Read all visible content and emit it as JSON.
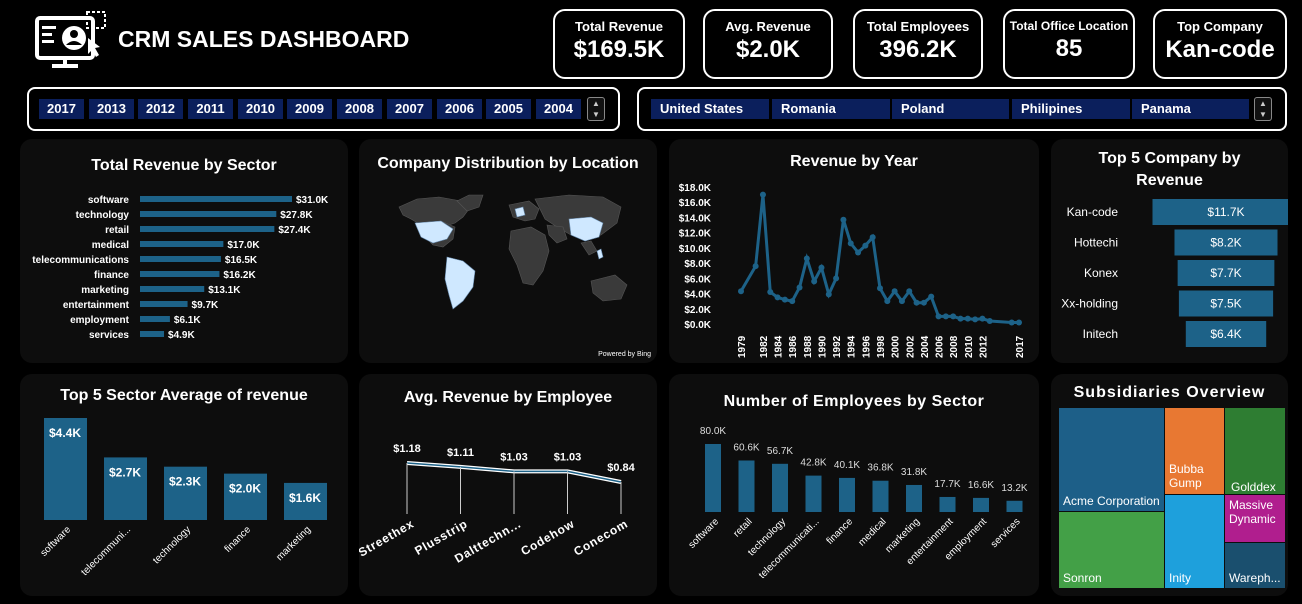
{
  "header": {
    "title": "CRM SALES DASHBOARD"
  },
  "kpis": [
    {
      "label": "Total Revenue",
      "value": "$169.5K"
    },
    {
      "label": "Avg. Revenue",
      "value": "$2.0K"
    },
    {
      "label": "Total Employees",
      "value": "396.2K"
    },
    {
      "label": "Total Office Location",
      "value": "85"
    },
    {
      "label": "Top Company",
      "value": "Kan-code"
    }
  ],
  "year_slicer": [
    "2017",
    "2013",
    "2012",
    "2011",
    "2010",
    "2009",
    "2008",
    "2007",
    "2006",
    "2005",
    "2004"
  ],
  "country_slicer": [
    "United States",
    "Romania",
    "Poland",
    "Philipines",
    "Panama"
  ],
  "panels": {
    "revenue_by_sector": "Total Revenue by Sector",
    "company_distribution": "Company Distribution by Location",
    "map_credit": "Powered by Bing",
    "revenue_by_year": "Revenue by Year",
    "top5_company": "Top 5 Company by Revenue",
    "top5_sector_avg": "Top 5 Sector Average of revenue",
    "avg_rev_employee": "Avg. Revenue by Employee",
    "employees_by_sector": "Number of Employees by Sector",
    "subsidiaries": "Subsidiaries Overview"
  },
  "colors": {
    "bar": "#1d6288",
    "bar_light": "#2a6f96",
    "map_highlight": "#cfe8ff",
    "map_land": "#3a3a3a",
    "line": "#1d6288"
  },
  "chart_data": [
    {
      "type": "bar",
      "orientation": "horizontal",
      "title": "Total Revenue by Sector",
      "categories": [
        "software",
        "technology",
        "retail",
        "medical",
        "telecommunications",
        "finance",
        "marketing",
        "entertainment",
        "employment",
        "services"
      ],
      "values": [
        31.0,
        27.8,
        27.4,
        17.0,
        16.5,
        16.2,
        13.1,
        9.7,
        6.1,
        4.9
      ],
      "labels": [
        "$31.0K",
        "$27.8K",
        "$27.4K",
        "$17.0K",
        "$16.5K",
        "$16.2K",
        "$13.1K",
        "$9.7K",
        "$6.1K",
        "$4.9K"
      ]
    },
    {
      "type": "line",
      "title": "Revenue by Year",
      "x": [
        1979,
        1981,
        1982,
        1983,
        1984,
        1985,
        1986,
        1987,
        1988,
        1989,
        1990,
        1991,
        1992,
        1993,
        1994,
        1995,
        1996,
        1997,
        1998,
        1999,
        2000,
        2001,
        2002,
        2003,
        2004,
        2005,
        2006,
        2007,
        2008,
        2009,
        2010,
        2011,
        2012,
        2013,
        2016,
        2017
      ],
      "y": [
        4.3,
        7.6,
        17.0,
        4.2,
        3.5,
        3.2,
        3.0,
        4.8,
        8.6,
        5.6,
        7.4,
        3.9,
        6.0,
        13.7,
        10.6,
        9.4,
        10.3,
        11.4,
        4.7,
        3.0,
        4.3,
        3.0,
        4.3,
        2.8,
        2.8,
        3.6,
        1.0,
        1.0,
        1.0,
        0.7,
        0.7,
        0.6,
        0.7,
        0.4,
        0.2,
        0.2
      ],
      "x_ticks": [
        "1979",
        "1982",
        "1984",
        "1986",
        "1988",
        "1990",
        "1992",
        "1994",
        "1996",
        "1998",
        "2000",
        "2002",
        "2004",
        "2006",
        "2008",
        "2010",
        "2012",
        "2017"
      ],
      "y_ticks": [
        "$18.0K",
        "$16.0K",
        "$14.0K",
        "$12.0K",
        "$10.0K",
        "$8.0K",
        "$6.0K",
        "$4.0K",
        "$2.0K",
        "$0.0K"
      ],
      "ylim": [
        0,
        18
      ]
    },
    {
      "type": "bar",
      "orientation": "horizontal",
      "title": "Top 5 Company by Revenue",
      "categories": [
        "Kan-code",
        "Hottechi",
        "Konex",
        "Xx-holding",
        "Initech"
      ],
      "values": [
        11.7,
        8.2,
        7.7,
        7.5,
        6.4
      ],
      "labels": [
        "$11.7K",
        "$8.2K",
        "$7.7K",
        "$7.5K",
        "$6.4K"
      ]
    },
    {
      "type": "bar",
      "title": "Top 5 Sector Average of revenue",
      "categories": [
        "software",
        "telecommuni...",
        "technology",
        "finance",
        "marketing"
      ],
      "values": [
        4.4,
        2.7,
        2.3,
        2.0,
        1.6
      ],
      "labels": [
        "$4.4K",
        "$2.7K",
        "$2.3K",
        "$2.0K",
        "$1.6K"
      ]
    },
    {
      "type": "line",
      "title": "Avg. Revenue by Employee",
      "categories": [
        "Streethex",
        "Plusstrip",
        "Dalttechn...",
        "Codehow",
        "Conecom"
      ],
      "values": [
        1.18,
        1.11,
        1.03,
        1.03,
        0.84
      ],
      "labels": [
        "$1.18",
        "$1.11",
        "$1.03",
        "$1.03",
        "$0.84"
      ]
    },
    {
      "type": "bar",
      "title": "Number of Employees by Sector",
      "categories": [
        "software",
        "retail",
        "technology",
        "telecommunicati...",
        "finance",
        "medical",
        "marketing",
        "entertainment",
        "employment",
        "services"
      ],
      "values": [
        80.0,
        60.6,
        56.7,
        42.8,
        40.1,
        36.8,
        31.8,
        17.7,
        16.6,
        13.2
      ],
      "labels": [
        "80.0K",
        "60.6K",
        "56.7K",
        "42.8K",
        "40.1K",
        "36.8K",
        "31.8K",
        "17.7K",
        "16.6K",
        "13.2K"
      ]
    },
    {
      "type": "treemap",
      "title": "Subsidiaries Overview",
      "items": [
        {
          "name": "Acme Corporation",
          "color": "#1d5f88"
        },
        {
          "name": "Bubba Gump",
          "color": "#e87832"
        },
        {
          "name": "Golddex",
          "color": "#2e7d32"
        },
        {
          "name": "Sonron",
          "color": "#43a047"
        },
        {
          "name": "Inity",
          "color": "#1ea0dc"
        },
        {
          "name": "Massive Dynamic",
          "color": "#b01e8e"
        },
        {
          "name": "Wareph...",
          "color": "#1a4f6e"
        }
      ]
    }
  ]
}
